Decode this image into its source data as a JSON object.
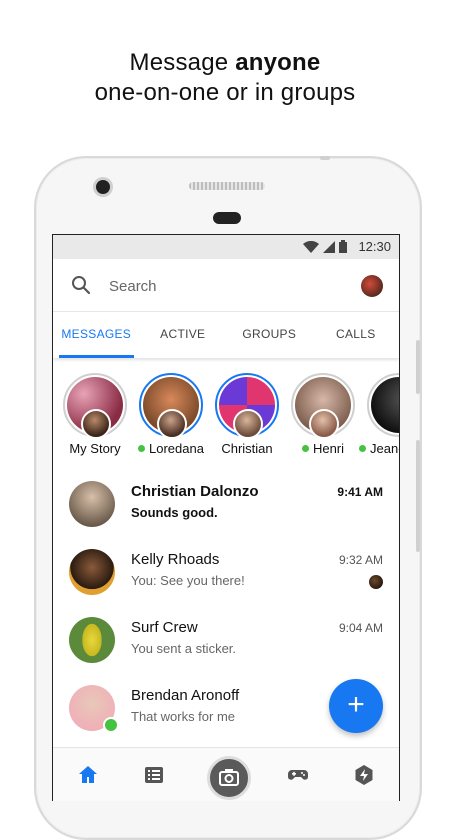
{
  "headline": {
    "line1_prefix": "Message ",
    "line1_bold": "anyone",
    "line2": "one-on-one or in groups"
  },
  "statusbar": {
    "time": "12:30"
  },
  "search": {
    "placeholder": "Search"
  },
  "tabs": [
    {
      "label": "MESSAGES",
      "active": true
    },
    {
      "label": "ACTIVE",
      "active": false
    },
    {
      "label": "GROUPS",
      "active": false
    },
    {
      "label": "CALLS",
      "active": false
    }
  ],
  "stories": [
    {
      "name": "My Story",
      "online": false
    },
    {
      "name": "Loredana",
      "online": true
    },
    {
      "name": "Christian",
      "online": false
    },
    {
      "name": "Henri",
      "online": true
    },
    {
      "name": "Jean-",
      "online": true
    }
  ],
  "conversations": [
    {
      "name": "Christian Dalonzo",
      "preview": "Sounds good.",
      "time": "9:41 AM",
      "unread": true
    },
    {
      "name": "Kelly Rhoads",
      "preview": "You: See you there!",
      "time": "9:32 AM",
      "unread": false
    },
    {
      "name": "Surf Crew",
      "preview": "You sent a sticker.",
      "time": "9:04 AM",
      "unread": false
    },
    {
      "name": "Brendan Aronoff",
      "preview": "That works for me",
      "time": "",
      "unread": false
    }
  ],
  "fab": {
    "icon": "plus-icon",
    "glyph": "+"
  },
  "bottom_nav": [
    "home-icon",
    "list-icon",
    "camera-icon",
    "games-icon",
    "discover-icon"
  ],
  "colors": {
    "accent": "#1778f2",
    "online": "#44c240"
  }
}
